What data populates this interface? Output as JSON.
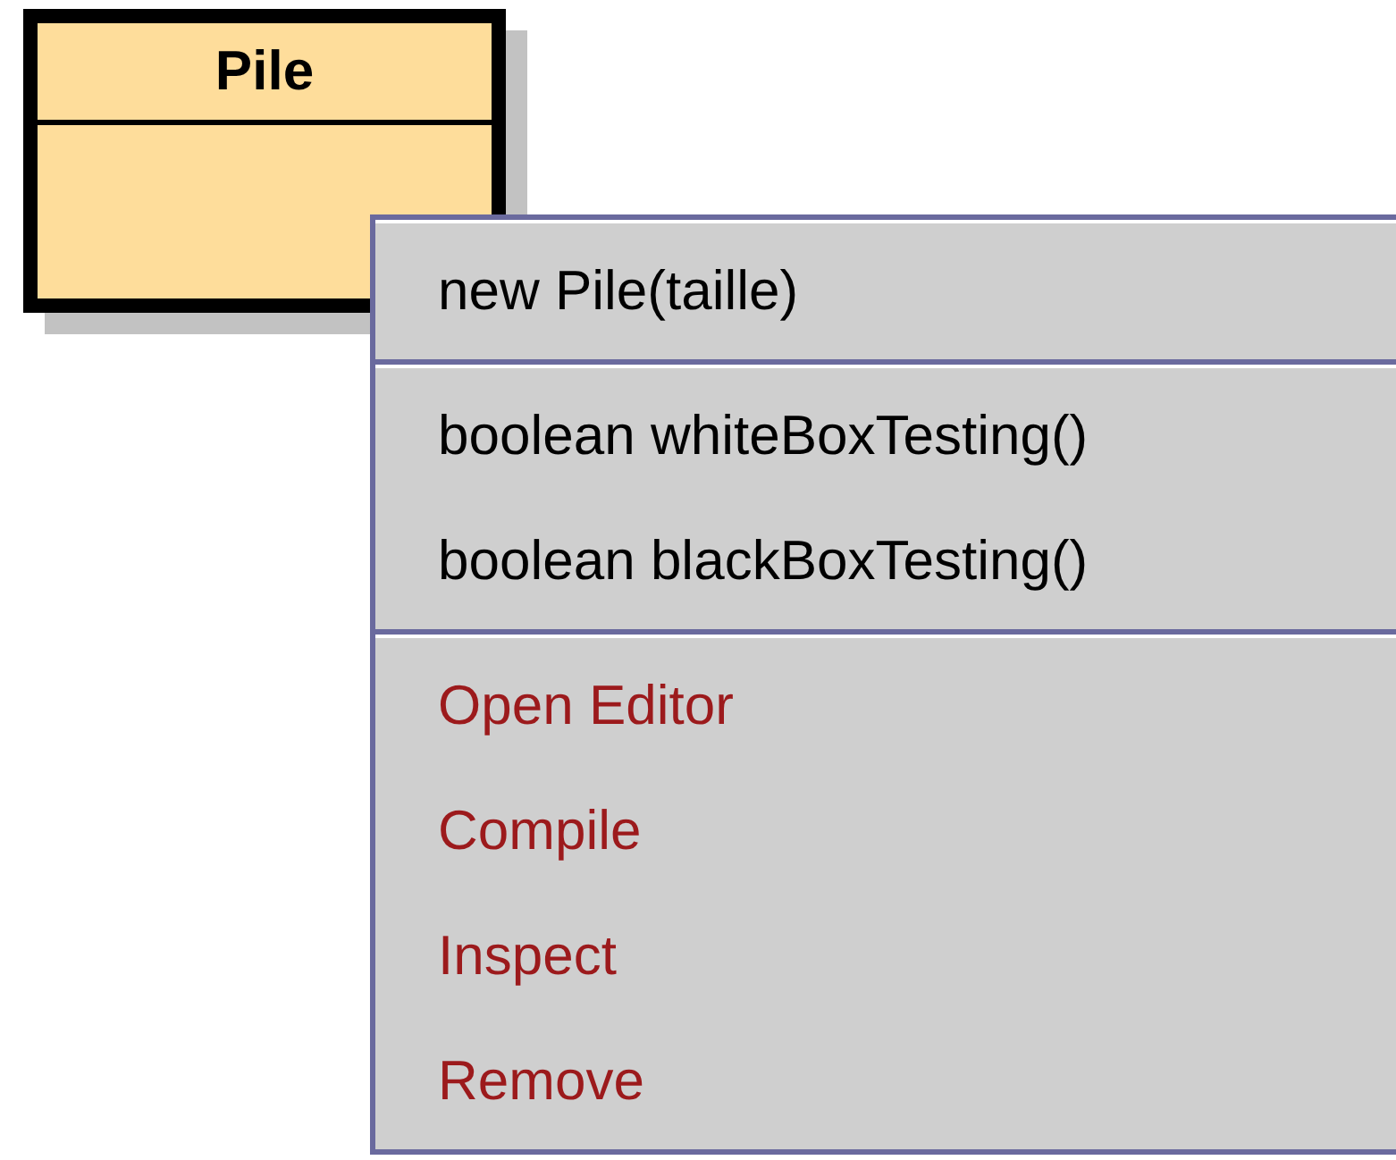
{
  "class_box": {
    "name": "Pile"
  },
  "context_menu": {
    "groups": [
      {
        "items": [
          {
            "label": "new Pile(taille)",
            "kind": "method"
          }
        ]
      },
      {
        "items": [
          {
            "label": "boolean whiteBoxTesting()",
            "kind": "method"
          },
          {
            "label": "boolean blackBoxTesting()",
            "kind": "method"
          }
        ]
      },
      {
        "items": [
          {
            "label": "Open Editor",
            "kind": "command"
          },
          {
            "label": "Compile",
            "kind": "command"
          },
          {
            "label": "Inspect",
            "kind": "command"
          },
          {
            "label": "Remove",
            "kind": "command"
          }
        ]
      }
    ]
  }
}
